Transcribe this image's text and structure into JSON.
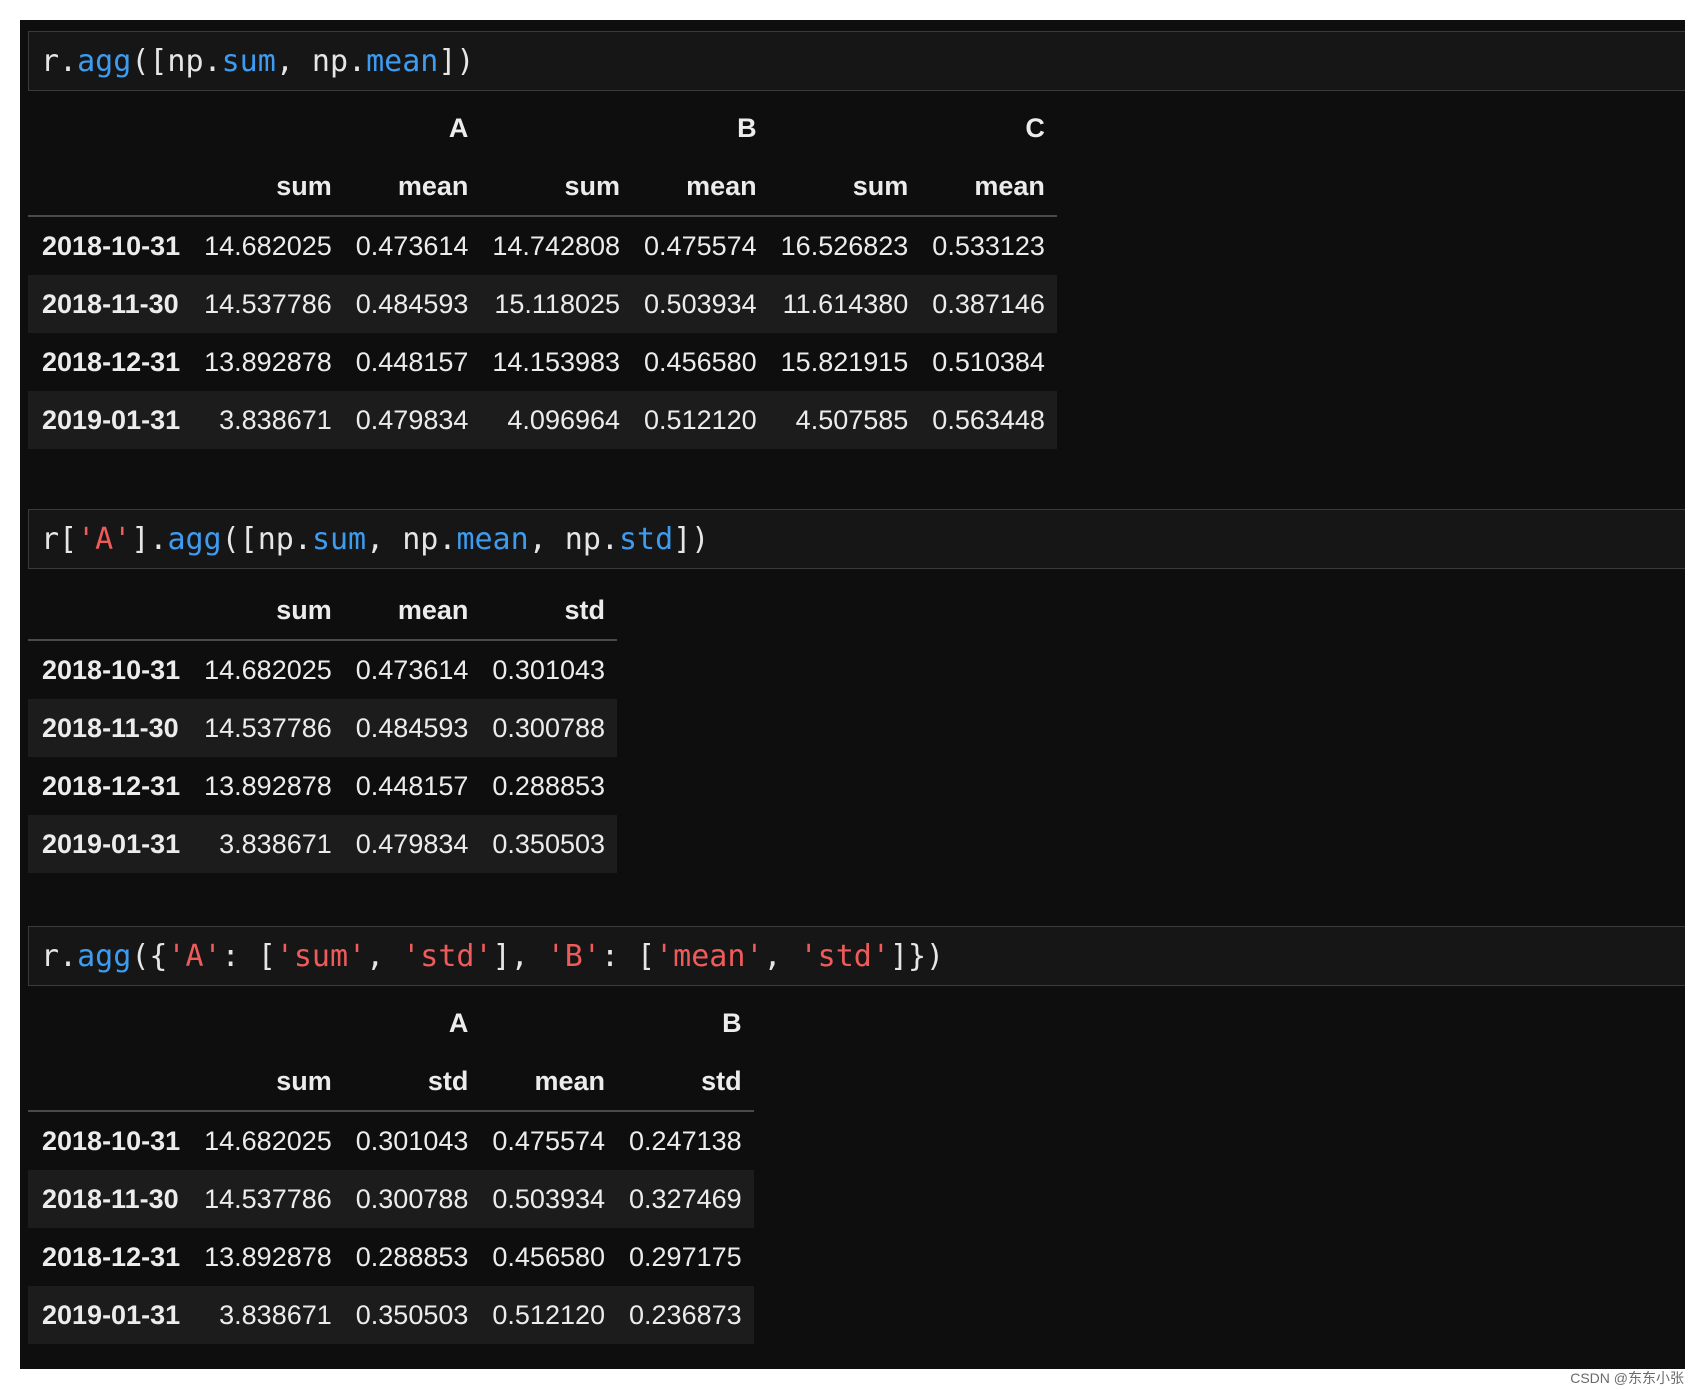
{
  "cells": [
    {
      "code_tokens": [
        {
          "t": "r.",
          "c": "plain"
        },
        {
          "t": "agg",
          "c": "fn"
        },
        {
          "t": "([np.",
          "c": "plain"
        },
        {
          "t": "sum",
          "c": "fn"
        },
        {
          "t": ", np.",
          "c": "plain"
        },
        {
          "t": "mean",
          "c": "fn"
        },
        {
          "t": "])",
          "c": "plain"
        }
      ],
      "top_header": [
        {
          "label": "",
          "span": 1
        },
        {
          "label": "A",
          "span": 2
        },
        {
          "label": "B",
          "span": 2
        },
        {
          "label": "C",
          "span": 2
        }
      ],
      "columns": [
        "sum",
        "mean",
        "sum",
        "mean",
        "sum",
        "mean"
      ],
      "rows": [
        {
          "index": "2018-10-31",
          "values": [
            "14.682025",
            "0.473614",
            "14.742808",
            "0.475574",
            "16.526823",
            "0.533123"
          ]
        },
        {
          "index": "2018-11-30",
          "values": [
            "14.537786",
            "0.484593",
            "15.118025",
            "0.503934",
            "11.614380",
            "0.387146"
          ]
        },
        {
          "index": "2018-12-31",
          "values": [
            "13.892878",
            "0.448157",
            "14.153983",
            "0.456580",
            "15.821915",
            "0.510384"
          ]
        },
        {
          "index": "2019-01-31",
          "values": [
            "3.838671",
            "0.479834",
            "4.096964",
            "0.512120",
            "4.507585",
            "0.563448"
          ]
        }
      ]
    },
    {
      "code_tokens": [
        {
          "t": "r[",
          "c": "plain"
        },
        {
          "t": "'A'",
          "c": "str"
        },
        {
          "t": "].",
          "c": "plain"
        },
        {
          "t": "agg",
          "c": "fn"
        },
        {
          "t": "([np.",
          "c": "plain"
        },
        {
          "t": "sum",
          "c": "fn"
        },
        {
          "t": ", np.",
          "c": "plain"
        },
        {
          "t": "mean",
          "c": "fn"
        },
        {
          "t": ", np.",
          "c": "plain"
        },
        {
          "t": "std",
          "c": "fn"
        },
        {
          "t": "])",
          "c": "plain"
        }
      ],
      "top_header": [],
      "columns": [
        "sum",
        "mean",
        "std"
      ],
      "rows": [
        {
          "index": "2018-10-31",
          "values": [
            "14.682025",
            "0.473614",
            "0.301043"
          ]
        },
        {
          "index": "2018-11-30",
          "values": [
            "14.537786",
            "0.484593",
            "0.300788"
          ]
        },
        {
          "index": "2018-12-31",
          "values": [
            "13.892878",
            "0.448157",
            "0.288853"
          ]
        },
        {
          "index": "2019-01-31",
          "values": [
            "3.838671",
            "0.479834",
            "0.350503"
          ]
        }
      ]
    },
    {
      "code_tokens": [
        {
          "t": "r.",
          "c": "plain"
        },
        {
          "t": "agg",
          "c": "fn"
        },
        {
          "t": "({",
          "c": "plain"
        },
        {
          "t": "'A'",
          "c": "str"
        },
        {
          "t": ": [",
          "c": "plain"
        },
        {
          "t": "'sum'",
          "c": "str"
        },
        {
          "t": ", ",
          "c": "plain"
        },
        {
          "t": "'std'",
          "c": "str"
        },
        {
          "t": "], ",
          "c": "plain"
        },
        {
          "t": "'B'",
          "c": "str"
        },
        {
          "t": ": [",
          "c": "plain"
        },
        {
          "t": "'mean'",
          "c": "str"
        },
        {
          "t": ", ",
          "c": "plain"
        },
        {
          "t": "'std'",
          "c": "str"
        },
        {
          "t": "]})",
          "c": "plain"
        }
      ],
      "top_header": [
        {
          "label": "",
          "span": 1
        },
        {
          "label": "A",
          "span": 2
        },
        {
          "label": "B",
          "span": 2
        }
      ],
      "columns": [
        "sum",
        "std",
        "mean",
        "std"
      ],
      "rows": [
        {
          "index": "2018-10-31",
          "values": [
            "14.682025",
            "0.301043",
            "0.475574",
            "0.247138"
          ]
        },
        {
          "index": "2018-11-30",
          "values": [
            "14.537786",
            "0.300788",
            "0.503934",
            "0.327469"
          ]
        },
        {
          "index": "2018-12-31",
          "values": [
            "13.892878",
            "0.288853",
            "0.456580",
            "0.297175"
          ]
        },
        {
          "index": "2019-01-31",
          "values": [
            "3.838671",
            "0.350503",
            "0.512120",
            "0.236873"
          ]
        }
      ]
    }
  ],
  "watermark": "CSDN @东东小张"
}
